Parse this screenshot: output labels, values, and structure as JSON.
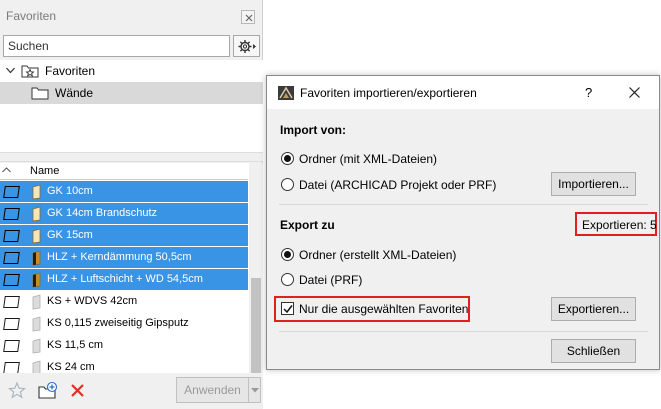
{
  "palette": {
    "title": "Favoriten",
    "search_placeholder": "Suchen",
    "tree": [
      {
        "label": "Favoriten"
      },
      {
        "label": "Wände"
      }
    ],
    "list_header": "Name",
    "items": [
      {
        "label": "GK 10cm",
        "selected": true
      },
      {
        "label": "GK 14cm Brandschutz",
        "selected": true
      },
      {
        "label": "GK 15cm",
        "selected": true
      },
      {
        "label": "HLZ + Kerndämmung 50,5cm",
        "selected": true
      },
      {
        "label": "HLZ + Luftschicht + WD 54,5cm",
        "selected": true
      },
      {
        "label": "KS + WDVS 42cm",
        "selected": false
      },
      {
        "label": "KS 0,115 zweiseitig Gipsputz",
        "selected": false
      },
      {
        "label": "KS 11,5 cm",
        "selected": false
      },
      {
        "label": "KS 24 cm",
        "selected": false
      }
    ],
    "apply_label": "Anwenden"
  },
  "dialog": {
    "title": "Favoriten importieren/exportieren",
    "help": "?",
    "import_heading": "Import von:",
    "import_option_folder": "Ordner (mit XML-Dateien)",
    "import_option_file": "Datei (ARCHICAD Projekt oder PRF)",
    "import_button": "Importieren...",
    "export_heading": "Export zu",
    "export_count": "Exportieren: 5",
    "export_option_folder": "Ordner (erstellt XML-Dateien)",
    "export_option_file": "Datei (PRF)",
    "only_selected_label": "Nur die ausgewählten Favoriten",
    "export_button": "Exportieren...",
    "close_button": "Schließen"
  },
  "colors": {
    "selection": "#3a94e6",
    "highlight": "#e02020",
    "delete_icon": "#e03020"
  }
}
